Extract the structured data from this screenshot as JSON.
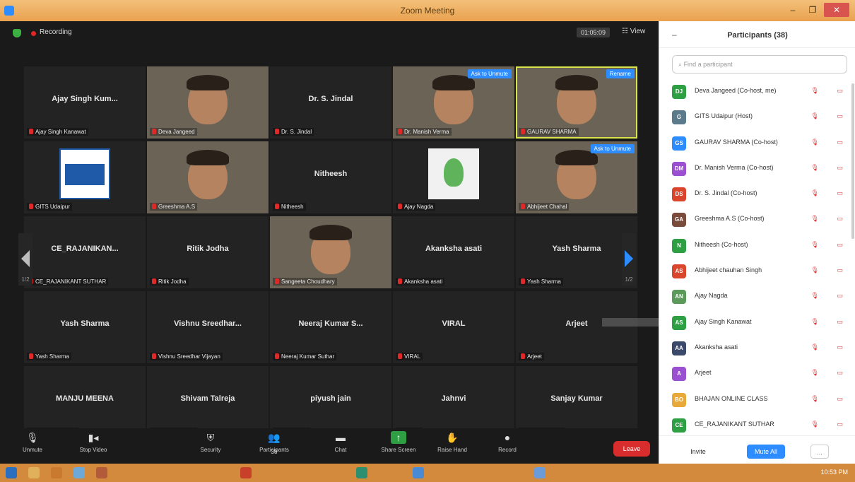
{
  "window": {
    "title": "Zoom Meeting"
  },
  "topbar": {
    "recording_label": "Recording",
    "timer": "01:05:09",
    "view_label": "View"
  },
  "tiles": [
    {
      "title": "Ajay Singh Kum...",
      "footer": "Ajay Singh Kanawat",
      "kind": "name"
    },
    {
      "title": "",
      "footer": "Deva Jangeed",
      "kind": "photo"
    },
    {
      "title": "Dr. S. Jindal",
      "footer": "Dr. S. Jindal",
      "kind": "name"
    },
    {
      "title": "",
      "footer": "Dr. Manish Verma",
      "kind": "photo",
      "badge": "Ask to Unmute"
    },
    {
      "title": "",
      "footer": "GAURAV SHARMA",
      "kind": "photo",
      "badge": "Rename",
      "highlight": true
    },
    {
      "title": "",
      "footer": "GITS Udaipur",
      "kind": "logo"
    },
    {
      "title": "",
      "footer": "Greeshma A.S",
      "kind": "photo"
    },
    {
      "title": "Nitheesh",
      "footer": "Nitheesh",
      "kind": "name"
    },
    {
      "title": "",
      "footer": "Ajay Nagda",
      "kind": "plant"
    },
    {
      "title": "",
      "footer": "Abhijeet Chahal",
      "kind": "photo",
      "badge": "Ask to Unmute"
    },
    {
      "title": "CE_RAJANIKAN...",
      "footer": "CE_RAJANIKANT SUTHAR",
      "kind": "name"
    },
    {
      "title": "Ritik Jodha",
      "footer": "Ritik Jodha",
      "kind": "name"
    },
    {
      "title": "",
      "footer": "Sangeeta Choudhary",
      "kind": "photo"
    },
    {
      "title": "Akanksha asati",
      "footer": "Akanksha asati",
      "kind": "name"
    },
    {
      "title": "Yash Sharma",
      "footer": "Yash Sharma",
      "kind": "name"
    },
    {
      "title": "Yash Sharma",
      "footer": "Yash Sharma",
      "kind": "name"
    },
    {
      "title": "Vishnu Sreedhar...",
      "footer": "Vishnu Sreedhar Vijayan",
      "kind": "name"
    },
    {
      "title": "Neeraj Kumar S...",
      "footer": "Neeraj Kumar Suthar",
      "kind": "name"
    },
    {
      "title": "VIRAL",
      "footer": "VIRAL",
      "kind": "name"
    },
    {
      "title": "Arjeet",
      "footer": "Arjeet",
      "kind": "name"
    },
    {
      "title": "MANJU MEENA",
      "footer": "MANJU MEENA",
      "kind": "name"
    },
    {
      "title": "Shivam Talreja",
      "footer": "Shivam Talreja",
      "kind": "name"
    },
    {
      "title": "piyush jain",
      "footer": "piyush jain",
      "kind": "name"
    },
    {
      "title": "Jahnvi",
      "footer": "Jahnvi",
      "kind": "name"
    },
    {
      "title": "Sanjay Kumar",
      "footer": "Sanjay Kumar",
      "kind": "name"
    }
  ],
  "nav": {
    "left_page": "1/2",
    "right_page": "1/2"
  },
  "toolbar": {
    "unmute": "Unmute",
    "stop_video": "Stop Video",
    "security": "Security",
    "participants": "Participants",
    "participants_count": "38",
    "chat": "Chat",
    "share_screen": "Share Screen",
    "raise_hand": "Raise Hand",
    "record": "Record",
    "leave": "Leave"
  },
  "panel": {
    "title": "Participants (38)",
    "search_placeholder": "Find a participant",
    "participants": [
      {
        "initials": "DJ",
        "color": "#2ea043",
        "name": "Deva Jangeed (Co-host, me)"
      },
      {
        "initials": "G",
        "color": "#5b7b8c",
        "name": "GITS Udaipur (Host)"
      },
      {
        "initials": "GS",
        "color": "#2d8cff",
        "name": "GAURAV SHARMA (Co-host)"
      },
      {
        "initials": "DM",
        "color": "#9b4fd1",
        "name": "Dr. Manish Verma (Co-host)"
      },
      {
        "initials": "DS",
        "color": "#d9452d",
        "name": "Dr. S. Jindal (Co-host)"
      },
      {
        "initials": "GA",
        "color": "#7a4a3a",
        "name": "Greeshma A.S (Co-host)"
      },
      {
        "initials": "N",
        "color": "#2ea043",
        "name": "Nitheesh (Co-host)"
      },
      {
        "initials": "AS",
        "color": "#d9452d",
        "name": "Abhijeet chauhan Singh"
      },
      {
        "initials": "AN",
        "color": "#5c9a5c",
        "name": "Ajay Nagda"
      },
      {
        "initials": "AS",
        "color": "#2ea043",
        "name": "Ajay Singh Kanawat"
      },
      {
        "initials": "AA",
        "color": "#3b4a6b",
        "name": "Akanksha asati"
      },
      {
        "initials": "A",
        "color": "#9b4fd1",
        "name": "Arjeet"
      },
      {
        "initials": "BO",
        "color": "#e8a93a",
        "name": "BHAJAN ONLINE CLASS"
      },
      {
        "initials": "CE",
        "color": "#2ea043",
        "name": "CE_RAJANIKANT SUTHAR"
      }
    ],
    "invite": "Invite",
    "mute_all": "Mute All",
    "more": "..."
  },
  "taskbar": {
    "clock": "10:53 PM"
  }
}
